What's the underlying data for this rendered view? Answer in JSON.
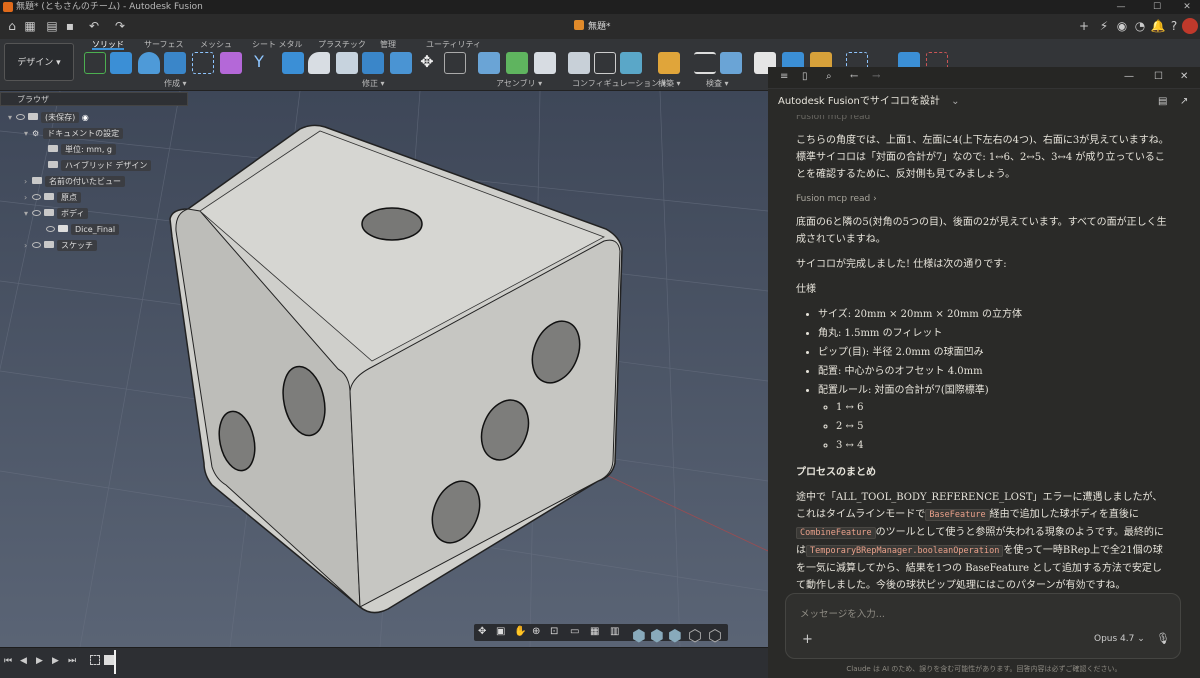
{
  "titlebar": {
    "title": "無題* (ともさんのチーム) - Autodesk Fusion",
    "min": "—",
    "max": "☐",
    "close": "✕"
  },
  "document_tab": "無題*",
  "workspace": "デザイン ▾",
  "toolbar_tabs": [
    "ソリッド",
    "サーフェス",
    "メッシュ",
    "シート メタル",
    "プラスチック",
    "管理",
    "ユーティリティ"
  ],
  "toolbar_groups": [
    "作成 ▾",
    "修正 ▾",
    "アセンブリ ▾",
    "コンフィギュレーション ▾",
    "構築 ▾",
    "検査 ▾"
  ],
  "browser": {
    "header": "ブラウザ",
    "root": "(未保存)",
    "doc_settings": "ドキュメントの設定",
    "units": "単位: mm, g",
    "hybrid": "ハイブリッド デザイン",
    "named_views": "名前の付いたビュー",
    "origin": "原点",
    "bodies": "ボディ",
    "body_item": "Dice_Final",
    "sketches": "スケッチ"
  },
  "claude": {
    "title": "Autodesk Fusionでサイコロを設計",
    "tool_top": "Fusion mcp read",
    "p1": "こちらの角度では、上面1、左面に4(上下左右の4つ)、右面に3が見えていますね。標準サイコロは「対面の合計が7」なので: 1↔6、2↔5、3↔4 が成り立っていることを確認するために、反対側も見てみましょう。",
    "tool2": "Fusion mcp read ›",
    "p2": "底面の6と隣の5(対角の5つの目)、後面の2が見えています。すべての面が正しく生成されていますね。",
    "p3": "サイコロが完成しました! 仕様は次の通りです:",
    "spec_title": "仕様",
    "specs": [
      "サイズ: 20mm × 20mm × 20mm の立方体",
      "角丸: 1.5mm のフィレット",
      "ピップ(目): 半径 2.0mm の球面凹み",
      "配置: 中心からのオフセット 4.0mm",
      "配置ルール: 対面の合計が7(国際標準)"
    ],
    "pairs": [
      "1 ↔ 6",
      "2 ↔ 5",
      "3 ↔ 4"
    ],
    "summary_title": "プロセスのまとめ",
    "s1": "途中で「ALL_TOOL_BODY_REFERENCE_LOST」エラーに遭遇しましたが、これはタイムラインモードで",
    "c1": "BaseFeature",
    "s2": "経由で追加した球ボディを直後に",
    "c2": "CombineFeature",
    "s3": "のツールとして使うと参照が失われる現象のようです。最終的には",
    "c3": "TemporaryBRepManager.booleanOperation",
    "s4": "を使って一時BRep上で全21個の球を一気に減算してから、結果を1つの BaseFeature として追加する方法で安定して動作しました。今後の球状ピップ処理にはこのパターンが有効ですね。",
    "placeholder": "メッセージを入力...",
    "model": "Opus 4.7 ⌄",
    "footer": "Claude は AI のため、誤りを含む可能性があります。回答内容は必ずご確認ください。"
  }
}
